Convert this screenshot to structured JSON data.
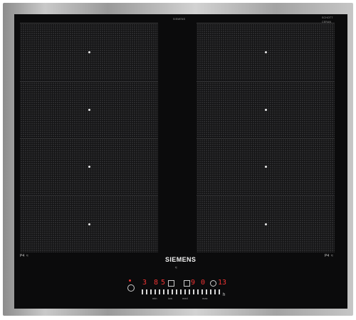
{
  "cooktop": {
    "brand": "SIEMENS",
    "model_text": "SIEMENS",
    "badge_lines": [
      "SCHOTT",
      "CERAN"
    ],
    "left_zone_label": "P4",
    "right_zone_label": "P4",
    "hob_symbol": "≈",
    "timer_value": "13",
    "left_display": [
      "3",
      "8",
      "5"
    ],
    "right_display": [
      "9",
      "0"
    ],
    "levels": [
      "min",
      "low",
      "med",
      "max"
    ],
    "boost_label": "h"
  },
  "colors": {
    "frame": "#b5b5b5",
    "glass": "#0b0b0c",
    "zone": "#2a2a2c",
    "display": "#e33333"
  }
}
